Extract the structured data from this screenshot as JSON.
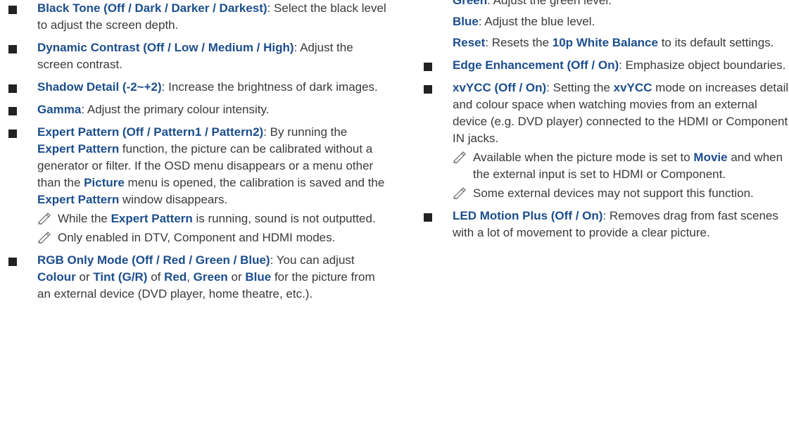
{
  "left_column": {
    "items": [
      {
        "title": "Black Tone (Off / Dark / Darker / Darkest)",
        "desc": ": Select the black level to adjust the screen depth."
      },
      {
        "title": "Dynamic Contrast (Off / Low / Medium / High)",
        "desc": ": Adjust the screen contrast."
      },
      {
        "title": "Shadow Detail (-2~+2)",
        "desc": ": Increase the brightness of dark images."
      },
      {
        "title": "Gamma",
        "desc": ": Adjust the primary colour intensity."
      }
    ],
    "expert_pattern": {
      "title": "Expert Pattern (Off / Pattern1 / Pattern2)",
      "p1": ": By running the ",
      "k1": "Expert Pattern",
      "p2": " function, the picture can be calibrated without a generator or filter. If the OSD menu disappears or a menu other than the ",
      "k2": "Picture",
      "p3": " menu is opened, the calibration is saved and the ",
      "k3": "Expert Pattern",
      "p4": " window disappears.",
      "note1_a": "While the ",
      "note1_k": "Expert Pattern",
      "note1_b": " is running, sound is not outputted.",
      "note2": "Only enabled in DTV, Component and HDMI modes."
    },
    "rgb_only": {
      "title": "RGB Only Mode (Off / Red / Green / Blue)",
      "p1": ": You can adjust ",
      "k1": "Colour",
      "p2": " or ",
      "k2": "Tint (G/R)",
      "p3": " of ",
      "k3": "Red",
      "p4": ", ",
      "k4": "Green",
      "p5": " or ",
      "k5": "Blue",
      "p6": " for the picture from an external device (DVD player, home theatre, etc.)."
    }
  },
  "right_column": {
    "green_label": "Green",
    "green_desc": ": Adjust the green level.",
    "blue_label": "Blue",
    "blue_desc": ": Adjust the blue level.",
    "reset_label": "Reset",
    "reset_p1": ": Resets the ",
    "reset_k": "10p White Balance",
    "reset_p2": " to its default settings.",
    "edge": {
      "title": "Edge Enhancement (Off / On)",
      "desc": ": Emphasize object boundaries."
    },
    "xvycc": {
      "title": "xvYCC (Off / On)",
      "p1": ": Setting the ",
      "k1": "xvYCC",
      "p2": " mode on increases detail and colour space when watching movies from an external device (e.g. DVD player) connected to the HDMI or Component IN jacks.",
      "note1_a": "Available when the picture mode is set to ",
      "note1_k": "Movie",
      "note1_b": " and when the external input is set to HDMI or Component.",
      "note2": "Some external devices may not support this function."
    },
    "led": {
      "title": "LED Motion Plus (Off / On)",
      "desc": ": Removes drag from fast scenes with a lot of movement to provide a clear picture."
    }
  },
  "icons": {
    "bullet": "square-bullet-icon",
    "note": "note-pencil-icon"
  },
  "colors": {
    "keyword": "#1c4e8c",
    "text": "#3a3a3a",
    "bullet": "#222222"
  }
}
